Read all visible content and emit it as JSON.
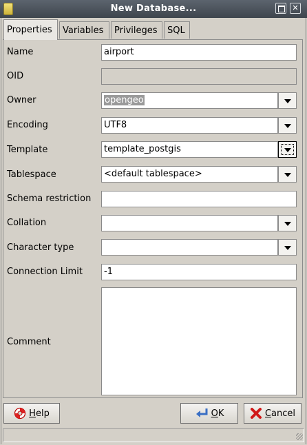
{
  "window": {
    "title": "New Database..."
  },
  "tabs": [
    {
      "label": "Properties",
      "active": true
    },
    {
      "label": "Variables"
    },
    {
      "label": "Privileges"
    },
    {
      "label": "SQL"
    }
  ],
  "form": {
    "name": {
      "label": "Name",
      "value": "airport"
    },
    "oid": {
      "label": "OID",
      "value": ""
    },
    "owner": {
      "label": "Owner",
      "value": "opengeo"
    },
    "encoding": {
      "label": "Encoding",
      "value": "UTF8"
    },
    "template": {
      "label": "Template",
      "value": "template_postgis"
    },
    "tablespace": {
      "label": "Tablespace",
      "value": "<default tablespace>"
    },
    "schema_restriction": {
      "label": "Schema restriction",
      "value": ""
    },
    "collation": {
      "label": "Collation",
      "value": ""
    },
    "character_type": {
      "label": "Character type",
      "value": ""
    },
    "connection_limit": {
      "label": "Connection Limit",
      "value": "-1"
    },
    "comment": {
      "label": "Comment",
      "value": ""
    }
  },
  "buttons": {
    "help": {
      "label_u": "H",
      "label_rest": "elp",
      "icon": "lifebuoy-icon"
    },
    "ok": {
      "label_u": "O",
      "label_rest": "K",
      "icon": "return-arrow-icon"
    },
    "cancel": {
      "label_u": "C",
      "label_rest": "ancel",
      "icon": "red-x-icon"
    }
  },
  "colors": {
    "titlebar": "#4a5159",
    "panel": "#d4d0c8",
    "selection": "#9a9a9a"
  }
}
